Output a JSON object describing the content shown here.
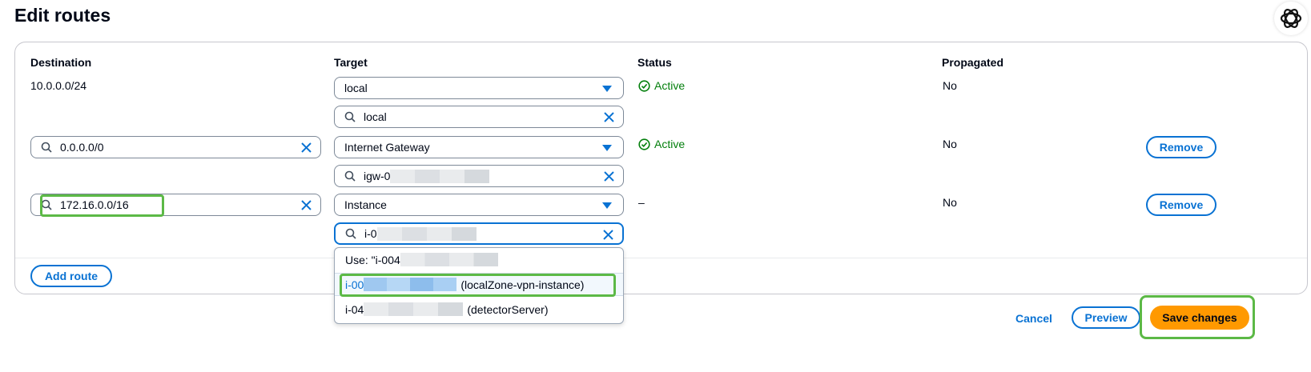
{
  "page": {
    "title": "Edit routes"
  },
  "columns": {
    "destination": "Destination",
    "target": "Target",
    "status": "Status",
    "propagated": "Propagated"
  },
  "routes": [
    {
      "destination": "10.0.0.0/24",
      "target_select": "local",
      "target_search": "local",
      "status": "Active",
      "propagated": "No"
    },
    {
      "destination": "0.0.0.0/0",
      "target_select": "Internet Gateway",
      "target_search": "igw-0",
      "status": "Active",
      "propagated": "No",
      "remove_label": "Remove"
    },
    {
      "destination": "172.16.0.0/16",
      "target_select": "Instance",
      "target_search": "i-0",
      "status": "–",
      "propagated": "No",
      "remove_label": "Remove"
    }
  ],
  "dropdown": {
    "use_option": {
      "prefix": "Use: \"i-004"
    },
    "options": [
      {
        "id_prefix": "i-00",
        "name": "(localZone-vpn-instance)",
        "selected": true
      },
      {
        "id_prefix": "i-04",
        "name": "(detectorServer)",
        "selected": false
      }
    ]
  },
  "actions": {
    "add_route": "Add route",
    "cancel": "Cancel",
    "preview": "Preview",
    "save": "Save changes"
  },
  "colors": {
    "link_blue": "#0972d3",
    "success_green": "#037f0c",
    "primary_orange": "#ff9900",
    "highlight_green": "#5cb946"
  },
  "icons": [
    "search-icon",
    "clear-x-icon",
    "caret-down-icon",
    "check-circle-icon",
    "assistant-logo-icon"
  ]
}
